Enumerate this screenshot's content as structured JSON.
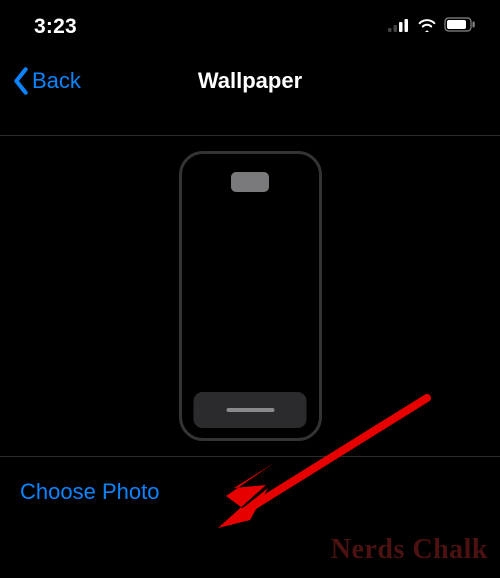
{
  "status": {
    "time": "3:23"
  },
  "nav": {
    "back_label": "Back",
    "title": "Wallpaper"
  },
  "action": {
    "choose_photo": "Choose Photo"
  },
  "watermark": "Nerds Chalk"
}
